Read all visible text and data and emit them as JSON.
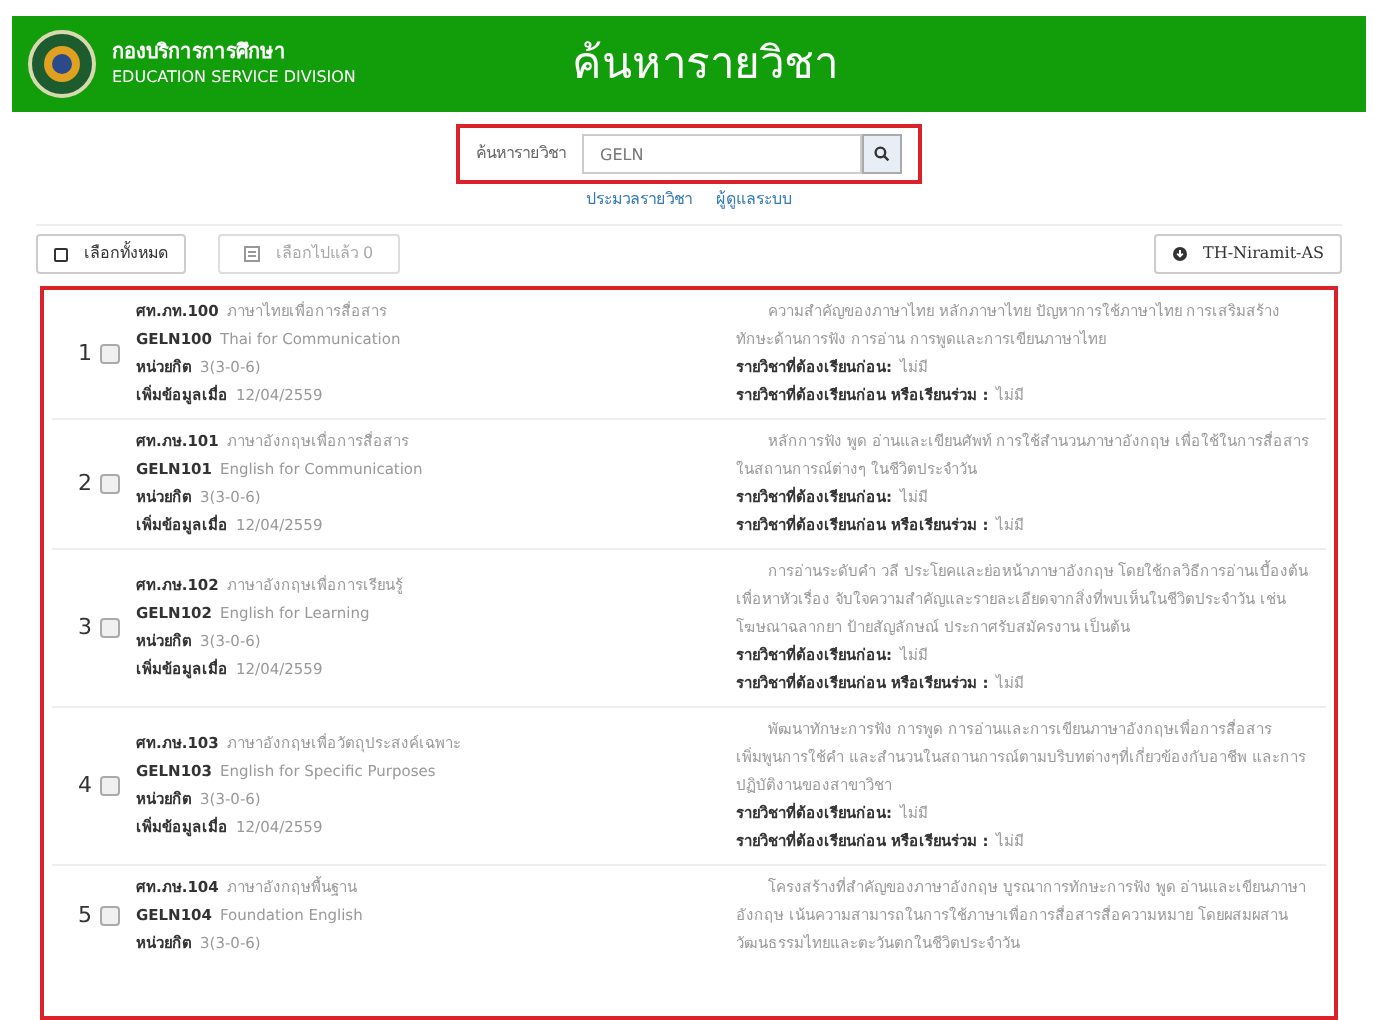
{
  "header": {
    "org_thai": "กองบริการการศึกษา",
    "org_english": "EDUCATION SERVICE DIVISION",
    "title": "ค้นหารายวิชา"
  },
  "search": {
    "label": "ค้นหารายวิชา",
    "value": "GELN",
    "highlighted": true
  },
  "links": [
    "ประมวลรายวิชา",
    "ผู้ดูแลระบบ"
  ],
  "toolbar": {
    "select_all": {
      "label": "เลือกทั้งหมด",
      "disabled": false
    },
    "selected_count": {
      "label": "เลือกไปแล้ว",
      "count": "0",
      "disabled": true
    },
    "font_button": {
      "label": "TH-Niramit-AS",
      "disabled": false
    }
  },
  "results": {
    "highlighted": true,
    "items": [
      {
        "number": "1",
        "checked": false,
        "title_code": "ศท.ภท.100",
        "title": "ภาษาไทยเพื่อการสื่อสาร",
        "code": "GELN100",
        "name_english": "Thai for Communication",
        "credits_label": "หน่วยกิต",
        "credits": "3(3-0-6)",
        "added_label": "เพิ่มข้อมูลเมื่อ",
        "added": "12/04/2559",
        "description": "ความสำคัญของภาษาไทย หลักภาษาไทย ปัญหาการใช้ภาษาไทย การเสริมสร้างทักษะด้านการฟัง การอ่าน การพูดและการเขียนภาษาไทย",
        "prereq_label": "รายวิชาที่ต้องเรียนก่อน:",
        "prereq": "ไม่มี",
        "coreq_label": "รายวิชาที่ต้องเรียนก่อน หรือเรียนร่วม :",
        "coreq": "ไม่มี"
      },
      {
        "number": "2",
        "checked": false,
        "title_code": "ศท.ภษ.101",
        "title": "ภาษาอังกฤษเพื่อการสื่อสาร",
        "code": "GELN101",
        "name_english": "English for Communication",
        "credits_label": "หน่วยกิต",
        "credits": "3(3-0-6)",
        "added_label": "เพิ่มข้อมูลเมื่อ",
        "added": "12/04/2559",
        "description": "หลักการฟัง พูด อ่านและเขียนศัพท์ การใช้สำนวนภาษาอังกฤษ เพื่อใช้ในการสื่อสารในสถานการณ์ต่างๆ ในชีวิตประจำวัน",
        "prereq_label": "รายวิชาที่ต้องเรียนก่อน:",
        "prereq": "ไม่มี",
        "coreq_label": "รายวิชาที่ต้องเรียนก่อน หรือเรียนร่วม :",
        "coreq": "ไม่มี"
      },
      {
        "number": "3",
        "checked": false,
        "title_code": "ศท.ภษ.102",
        "title": "ภาษาอังกฤษเพื่อการเรียนรู้",
        "code": "GELN102",
        "name_english": "English for Learning",
        "credits_label": "หน่วยกิต",
        "credits": "3(3-0-6)",
        "added_label": "เพิ่มข้อมูลเมื่อ",
        "added": "12/04/2559",
        "description": "การอ่านระดับคำ วลี ประโยคและย่อหน้าภาษาอังกฤษ โดยใช้กลวิธีการอ่านเบื้องต้นเพื่อหาหัวเรื่อง จับใจความสำคัญและรายละเอียดจากสิ่งที่พบเห็นในชีวิตประจำวัน เช่น โฆษณาฉลากยา ป้ายสัญลักษณ์ ประกาศรับสมัครงาน เป็นต้น",
        "prereq_label": "รายวิชาที่ต้องเรียนก่อน:",
        "prereq": "ไม่มี",
        "coreq_label": "รายวิชาที่ต้องเรียนก่อน หรือเรียนร่วม :",
        "coreq": "ไม่มี"
      },
      {
        "number": "4",
        "checked": false,
        "title_code": "ศท.ภษ.103",
        "title": "ภาษาอังกฤษเพื่อวัตถุประสงค์เฉพาะ",
        "code": "GELN103",
        "name_english": "English for Specific Purposes",
        "credits_label": "หน่วยกิต",
        "credits": "3(3-0-6)",
        "added_label": "เพิ่มข้อมูลเมื่อ",
        "added": "12/04/2559",
        "description": "พัฒนาทักษะการฟัง การพูด การอ่านและการเขียนภาษาอังกฤษเพื่อการสื่อสาร เพิ่มพูนการใช้คำ และสำนวนในสถานการณ์ตามบริบทต่างๆที่เกี่ยวข้องกับอาชีพ และการปฏิบัติงานของสาขาวิชา",
        "prereq_label": "รายวิชาที่ต้องเรียนก่อน:",
        "prereq": "ไม่มี",
        "coreq_label": "รายวิชาที่ต้องเรียนก่อน หรือเรียนร่วม :",
        "coreq": "ไม่มี"
      },
      {
        "number": "5",
        "checked": false,
        "title_code": "ศท.ภษ.104",
        "title": "ภาษาอังกฤษพื้นฐาน",
        "code": "GELN104",
        "name_english": "Foundation English",
        "credits_label": "หน่วยกิต",
        "credits": "3(3-0-6)",
        "description": "โครงสร้างที่สำคัญของภาษาอังกฤษ บูรณาการทักษะการฟัง พูด อ่านและเขียนภาษาอังกฤษ เน้นความสามารถในการใช้ภาษาเพื่อการสื่อสารสื่อความหมาย โดยผสมผสานวัฒนธรรมไทยและตะวันตกในชีวิตประจำวัน"
      }
    ]
  }
}
